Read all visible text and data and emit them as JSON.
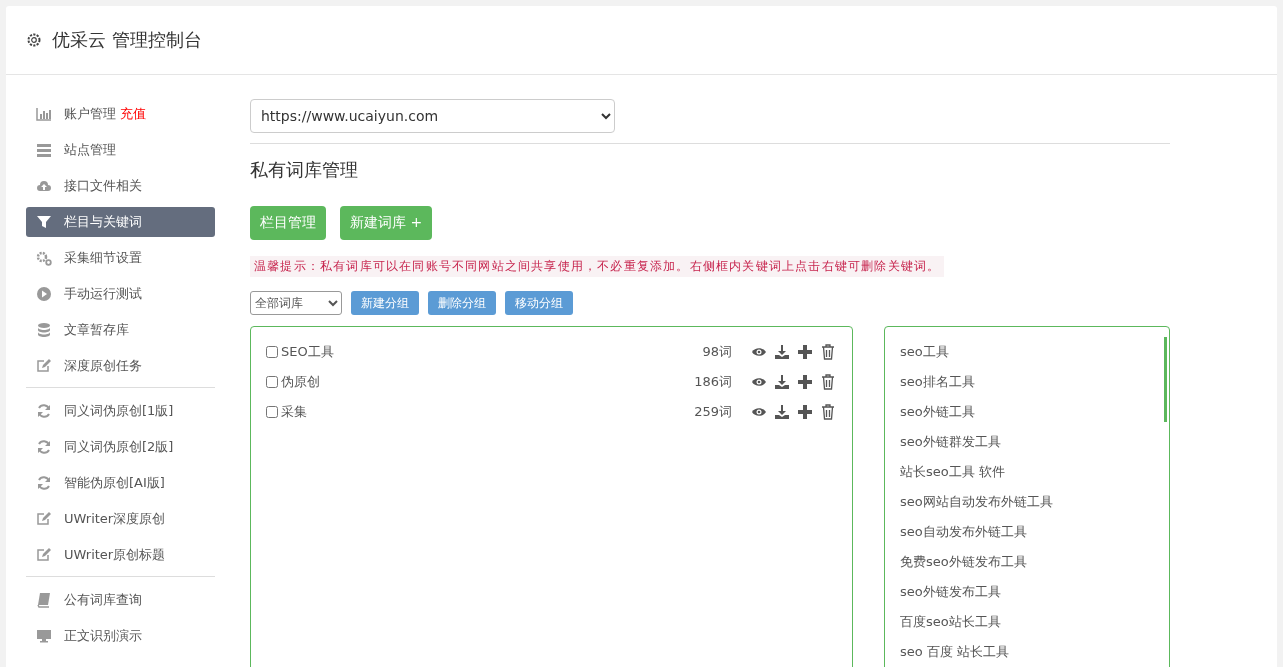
{
  "header": {
    "title": "优采云 管理控制台"
  },
  "sidebar": {
    "groups": [
      {
        "items": [
          {
            "label": "账户管理",
            "badge": "充值",
            "selected": false
          },
          {
            "label": "站点管理",
            "selected": false
          },
          {
            "label": "接口文件相关",
            "selected": false
          },
          {
            "label": "栏目与关键词",
            "selected": true
          },
          {
            "label": "采集细节设置",
            "selected": false
          },
          {
            "label": "手动运行测试",
            "selected": false
          },
          {
            "label": "文章暂存库",
            "selected": false
          },
          {
            "label": "深度原创任务",
            "selected": false
          }
        ]
      },
      {
        "items": [
          {
            "label": "同义词伪原创[1版]",
            "selected": false
          },
          {
            "label": "同义词伪原创[2版]",
            "selected": false
          },
          {
            "label": "智能伪原创[AI版]",
            "selected": false
          },
          {
            "label": "UWriter深度原创",
            "selected": false
          },
          {
            "label": "UWriter原创标题",
            "selected": false
          }
        ]
      },
      {
        "items": [
          {
            "label": "公有词库查询",
            "selected": false
          },
          {
            "label": "正文识别演示",
            "selected": false
          }
        ]
      }
    ]
  },
  "main": {
    "site_select": {
      "value": "https://www.ucaiyun.com"
    },
    "heading": "私有词库管理",
    "buttons": [
      "栏目管理",
      "新建词库 +"
    ],
    "tip": "温馨提示：私有词库可以在同账号不同网站之间共享使用，不必重复添加。右侧框内关键词上点击右键可删除关键词。",
    "group_filter": {
      "value": "全部词库"
    },
    "group_buttons": [
      "新建分组",
      "删除分组",
      "移动分组"
    ],
    "libraries": [
      {
        "name": "SEO工具",
        "count": "98词",
        "checked": false
      },
      {
        "name": "伪原创",
        "count": "186词",
        "checked": false
      },
      {
        "name": "采集",
        "count": "259词",
        "checked": false
      }
    ],
    "keywords": [
      "seo工具",
      "seo排名工具",
      "seo外链工具",
      "seo外链群发工具",
      "站长seo工具 软件",
      "seo网站自动发布外链工具",
      "seo自动发布外链工具",
      "免费seo外链发布工具",
      "seo外链发布工具",
      "百度seo站长工具",
      "seo 百度 站长工具"
    ]
  }
}
